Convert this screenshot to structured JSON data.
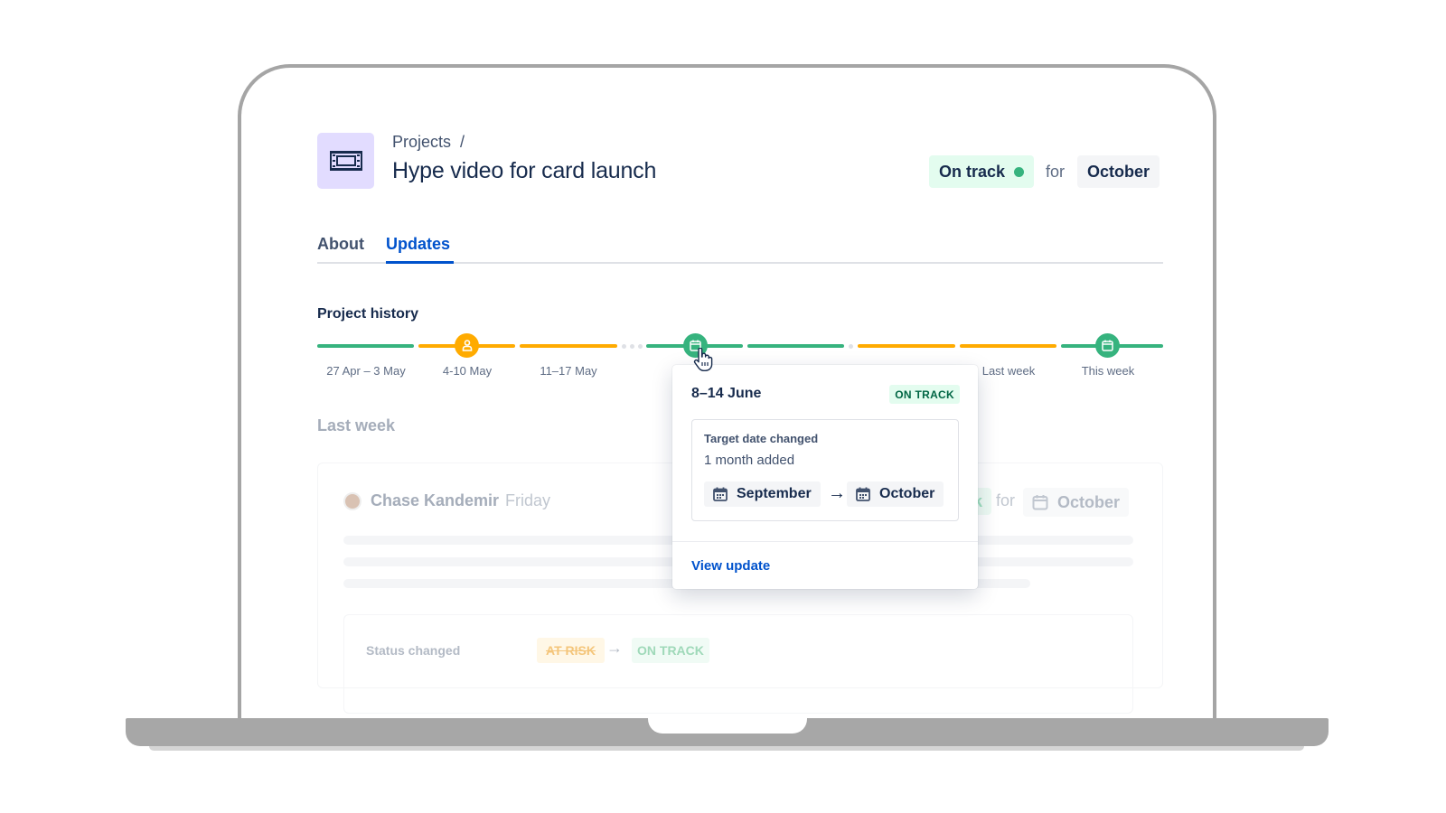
{
  "header": {
    "breadcrumb": "Projects",
    "breadcrumb_separator": "/",
    "title": "Hype video for card launch",
    "status_label": "On track",
    "for_text": "for",
    "target_month": "October"
  },
  "tabs": [
    {
      "label": "About",
      "active": false
    },
    {
      "label": "Updates",
      "active": true
    }
  ],
  "history": {
    "title": "Project history",
    "labels": [
      "27 Apr – 3 May",
      "4-10 May",
      "11–17 May",
      "Last week",
      "This week"
    ]
  },
  "section": {
    "title": "Last week",
    "author": "Chase Kandemir",
    "day": "Friday",
    "status_tail": "k",
    "for_text": "for",
    "month": "October",
    "status_changed_label": "Status changed",
    "from_status": "AT RISK",
    "to_status": "ON TRACK"
  },
  "popup": {
    "date_range": "8–14 June",
    "status": "ON TRACK",
    "change_title": "Target date changed",
    "change_detail": "1 month added",
    "from_month": "September",
    "to_month": "October",
    "link": "View update"
  },
  "colors": {
    "green": "#36b37e",
    "orange": "#ffab00",
    "link_blue": "#0052cc",
    "icon_bg": "#e2dcff"
  }
}
